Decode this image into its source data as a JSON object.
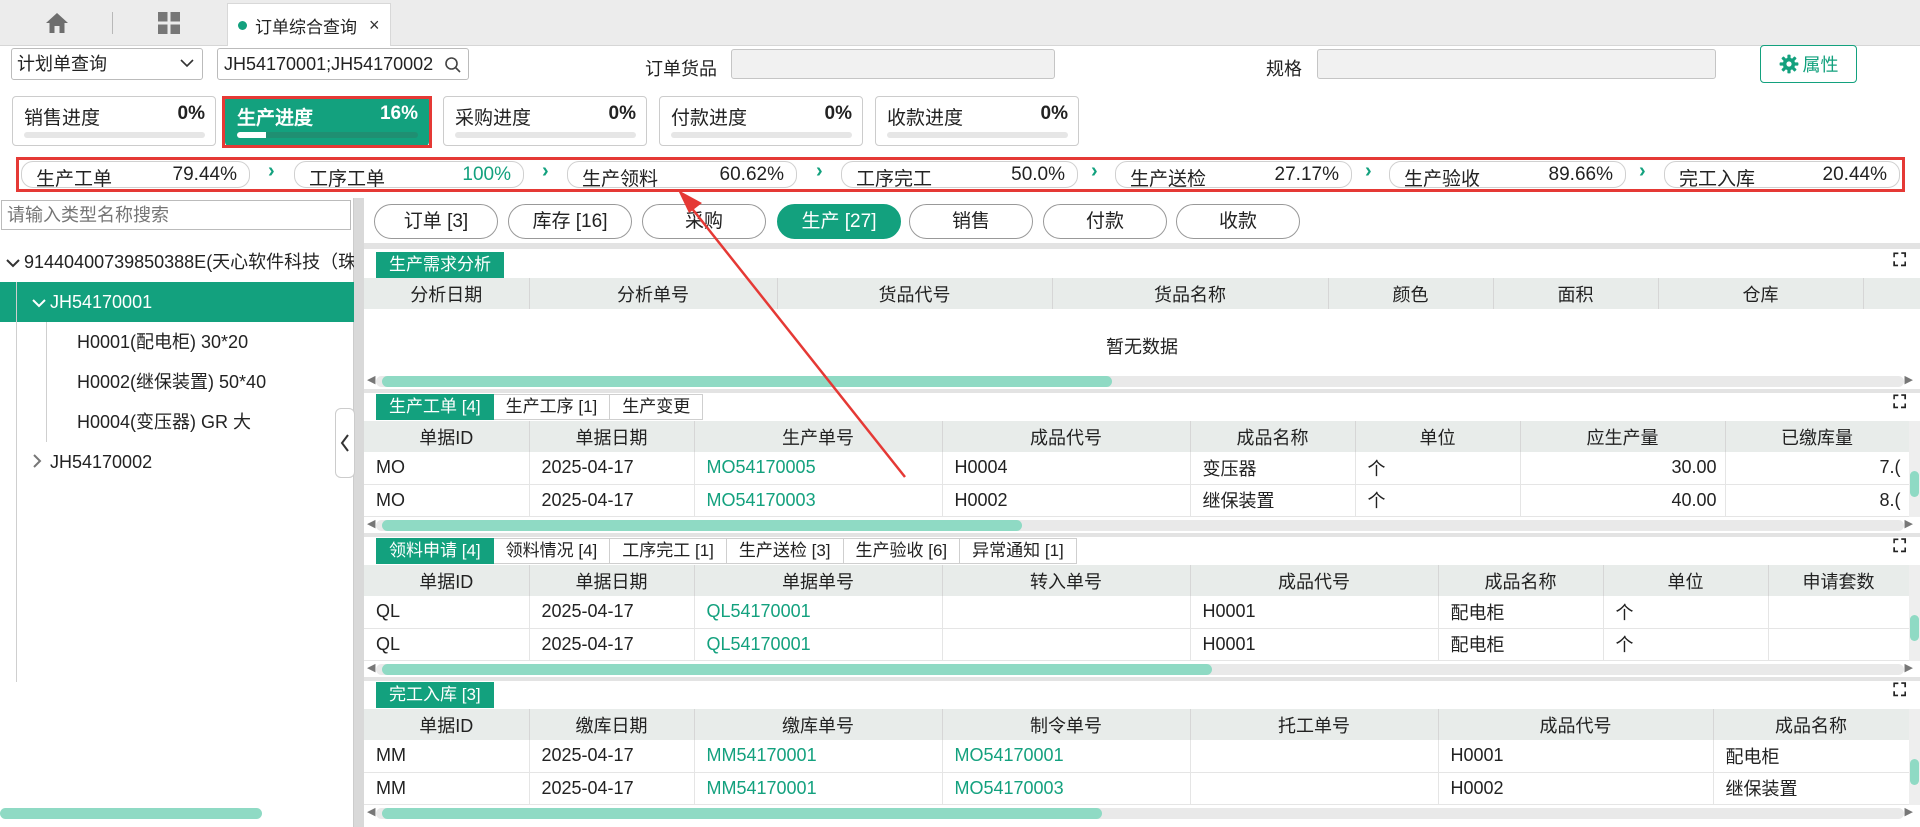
{
  "tabbar": {
    "active_tab": "订单综合查询",
    "close": "×"
  },
  "query": {
    "mode": "计划单查询",
    "search_value": "JH54170001;JH54170002",
    "goods_label": "订单货品",
    "spec_label": "规格",
    "attr_button": "属性"
  },
  "progress_cards": [
    {
      "label": "销售进度",
      "value": "0%",
      "pct": 0
    },
    {
      "label": "生产进度",
      "value": "16%",
      "pct": 16
    },
    {
      "label": "采购进度",
      "value": "0%",
      "pct": 0
    },
    {
      "label": "付款进度",
      "value": "0%",
      "pct": 0
    },
    {
      "label": "收款进度",
      "value": "0%",
      "pct": 0
    }
  ],
  "steps": [
    {
      "label": "生产工单",
      "value": "79.44%"
    },
    {
      "label": "工序工单",
      "value": "100%"
    },
    {
      "label": "生产领料",
      "value": "60.62%"
    },
    {
      "label": "工序完工",
      "value": "50.0%"
    },
    {
      "label": "生产送检",
      "value": "27.17%"
    },
    {
      "label": "生产验收",
      "value": "89.66%"
    },
    {
      "label": "完工入库",
      "value": "20.44%"
    }
  ],
  "tree": {
    "search_placeholder": "请输入类型名称搜索",
    "root": "91440400739850388E(天心软件科技（珠",
    "node1": "JH54170001",
    "children": [
      "H0001(配电柜) 30*20",
      "H0002(继保装置) 50*40",
      "H0004(变压器) GR 大"
    ],
    "node2": "JH54170002"
  },
  "category_pills": [
    "订单 [3]",
    "库存 [16]",
    "采购",
    "生产 [27]",
    "销售",
    "付款",
    "收款"
  ],
  "demand": {
    "tab": "生产需求分析",
    "columns": [
      "分析日期",
      "分析单号",
      "货品代号",
      "货品名称",
      "颜色",
      "面积",
      "仓库"
    ],
    "empty_text": "暂无数据"
  },
  "production": {
    "tabs": [
      "生产工单 [4]",
      "生产工序 [1]",
      "生产变更"
    ],
    "columns": [
      "单据ID",
      "单据日期",
      "生产单号",
      "成品代号",
      "成品名称",
      "单位",
      "应生产量",
      "已缴库量"
    ],
    "rows": [
      [
        "MO",
        "2025-04-17",
        "MO54170005",
        "H0004",
        "变压器",
        "个",
        "30.00",
        "7.("
      ],
      [
        "MO",
        "2025-04-17",
        "MO54170003",
        "H0002",
        "继保装置",
        "个",
        "40.00",
        "8.("
      ]
    ]
  },
  "material": {
    "tabs": [
      "领料申请 [4]",
      "领料情况 [4]",
      "工序完工 [1]",
      "生产送检 [3]",
      "生产验收 [6]",
      "异常通知 [1]"
    ],
    "columns": [
      "单据ID",
      "单据日期",
      "单据单号",
      "转入单号",
      "成品代号",
      "成品名称",
      "单位",
      "申请套数"
    ],
    "rows": [
      [
        "QL",
        "2025-04-17",
        "QL54170001",
        "",
        "H0001",
        "配电柜",
        "个",
        ""
      ],
      [
        "QL",
        "2025-04-17",
        "QL54170001",
        "",
        "H0001",
        "配电柜",
        "个",
        ""
      ]
    ]
  },
  "stockin": {
    "tabs": [
      "完工入库 [3]"
    ],
    "columns": [
      "单据ID",
      "缴库日期",
      "缴库单号",
      "制令单号",
      "托工单号",
      "成品代号",
      "成品名称"
    ],
    "rows": [
      [
        "MM",
        "2025-04-17",
        "MM54170001",
        "MO54170001",
        "",
        "H0001",
        "配电柜"
      ],
      [
        "MM",
        "2025-04-17",
        "MM54170001",
        "MO54170003",
        "",
        "H0002",
        "继保装置"
      ]
    ]
  },
  "colors": {
    "accent": "#13a17e",
    "highlight": "#e53935"
  }
}
